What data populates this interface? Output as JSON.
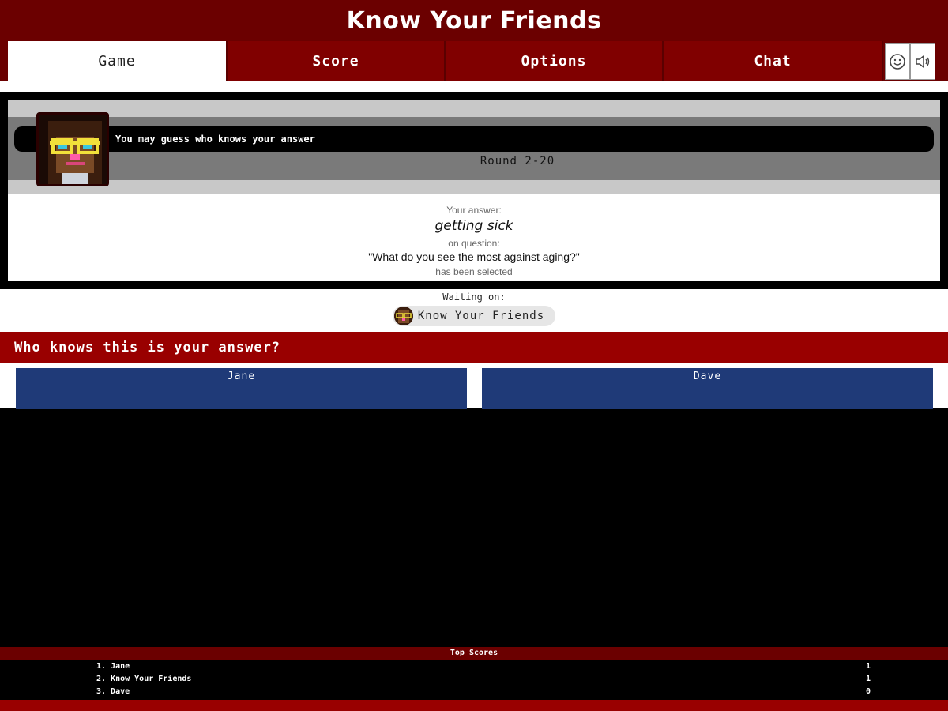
{
  "app": {
    "title": "Know Your Friends"
  },
  "tabs": [
    {
      "label": "Game",
      "active": true
    },
    {
      "label": "Score",
      "active": false
    },
    {
      "label": "Options",
      "active": false
    },
    {
      "label": "Chat",
      "active": false
    }
  ],
  "toolbar_icons": [
    "smiley-icon",
    "speaker-icon"
  ],
  "game": {
    "prompt": "You may guess who knows your answer",
    "round": "Round 2-20",
    "answer_label": "Your answer:",
    "answer": "getting sick",
    "question_label": "on question:",
    "question": "\"What do you see the most against aging?\"",
    "selected_label": "has been selected"
  },
  "waiting": {
    "label": "Waiting on:",
    "player": "Know Your Friends"
  },
  "guess": {
    "heading": "Who knows this is your answer?",
    "friends": [
      "Jane",
      "Dave"
    ]
  },
  "top_scores": {
    "title": "Top Scores",
    "entries": [
      {
        "rank_name": "1. Jane",
        "score": "1"
      },
      {
        "rank_name": "2. Know Your Friends",
        "score": "1"
      },
      {
        "rank_name": "3. Dave",
        "score": "0"
      }
    ]
  },
  "colors": {
    "brand_dark": "#6b0000",
    "brand_red": "#990000",
    "friend_blue": "#1f3a78"
  }
}
